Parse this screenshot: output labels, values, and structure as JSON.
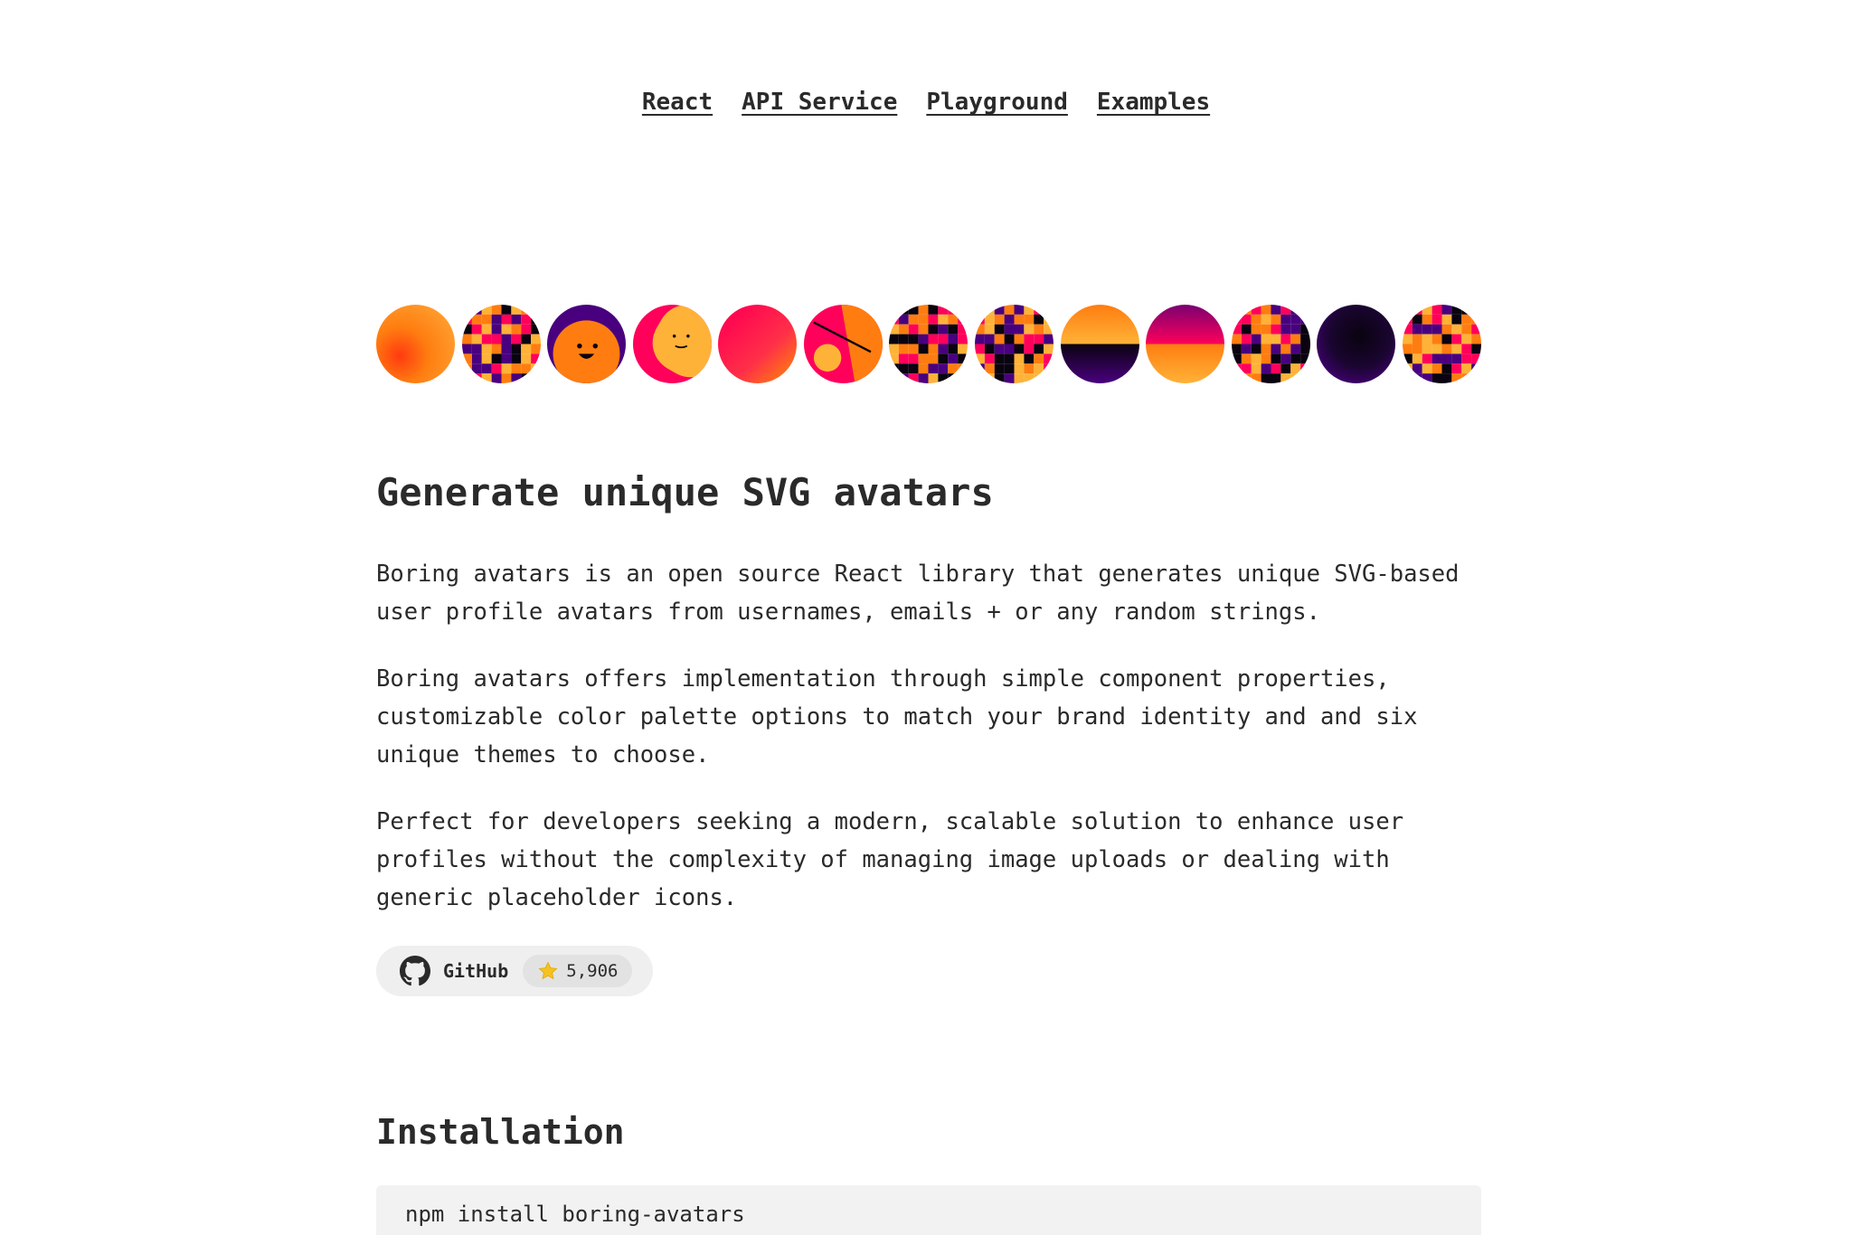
{
  "nav": {
    "items": [
      {
        "label": "React"
      },
      {
        "label": "API Service"
      },
      {
        "label": "Playground"
      },
      {
        "label": "Examples"
      }
    ]
  },
  "colors": {
    "palette": [
      "#0a0310",
      "#49007e",
      "#ff005b",
      "#ff7d10",
      "#ffb238"
    ],
    "text": "#2a2a2a",
    "badge_bg": "#efefef",
    "code_bg": "#f2f2f2"
  },
  "avatars": [
    {
      "variant": "marble"
    },
    {
      "variant": "pixel"
    },
    {
      "variant": "beam"
    },
    {
      "variant": "beam"
    },
    {
      "variant": "marble"
    },
    {
      "variant": "bauhaus"
    },
    {
      "variant": "pixel"
    },
    {
      "variant": "pixel"
    },
    {
      "variant": "sunset"
    },
    {
      "variant": "sunset"
    },
    {
      "variant": "pixel"
    },
    {
      "variant": "marble"
    },
    {
      "variant": "pixel"
    }
  ],
  "hero": {
    "title": "Generate unique SVG avatars",
    "paragraphs": [
      "Boring avatars is an open source React library that generates unique SVG-based user profile avatars from usernames, emails + or any random strings.",
      "Boring avatars offers implementation through simple component properties, customizable color palette options to match your brand identity and and six unique themes to choose.",
      "Perfect for developers seeking a modern, scalable solution to enhance user profiles without the complexity of managing image uploads or dealing with generic placeholder icons."
    ]
  },
  "github": {
    "label": "GitHub",
    "stars": "5,906",
    "icon": "github-icon",
    "star_icon": "star-icon"
  },
  "installation": {
    "heading": "Installation",
    "command": "npm install boring-avatars"
  }
}
